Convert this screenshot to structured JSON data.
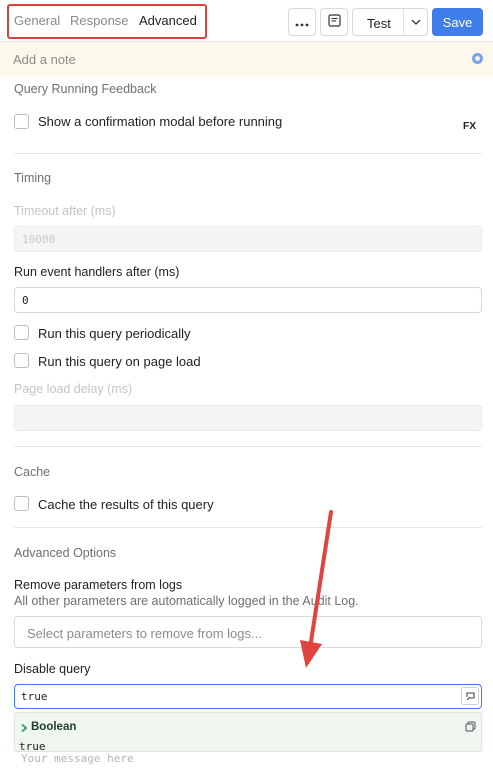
{
  "tabs": [
    {
      "label": "General",
      "active": false
    },
    {
      "label": "Response",
      "active": false
    },
    {
      "label": "Advanced",
      "active": true
    }
  ],
  "toolbar": {
    "more_icon": "more-horizontal-icon",
    "notes_icon": "notes-icon",
    "test_label": "Test",
    "save_label": "Save",
    "accent": "#3f7dea"
  },
  "note": {
    "placeholder": "Add a note"
  },
  "query_running": {
    "title": "Query Running Feedback",
    "confirm_label": "Show a confirmation modal before running",
    "fx_label": "FX"
  },
  "timing": {
    "title": "Timing",
    "timeout_label": "Timeout after (ms)",
    "timeout_value": "10000",
    "run_after_label": "Run event handlers after (ms)",
    "run_after_value": "0",
    "periodic_label": "Run this query periodically",
    "page_load_label": "Run this query on page load",
    "page_load_delay_label": "Page load delay (ms)",
    "page_load_delay_value": ""
  },
  "cache": {
    "title": "Cache",
    "cache_label": "Cache the results of this query"
  },
  "advanced": {
    "title": "Advanced Options",
    "remove_params_label": "Remove parameters from logs",
    "remove_params_help": "All other parameters are automatically logged in the Audit Log.",
    "remove_params_placeholder": "Select parameters to remove from logs...",
    "disable_label": "Disable query",
    "disable_value": "true",
    "preview_type": "Boolean",
    "preview_value": "true",
    "message_placeholder": "Your message here"
  },
  "annotation_color": "#d9413b"
}
